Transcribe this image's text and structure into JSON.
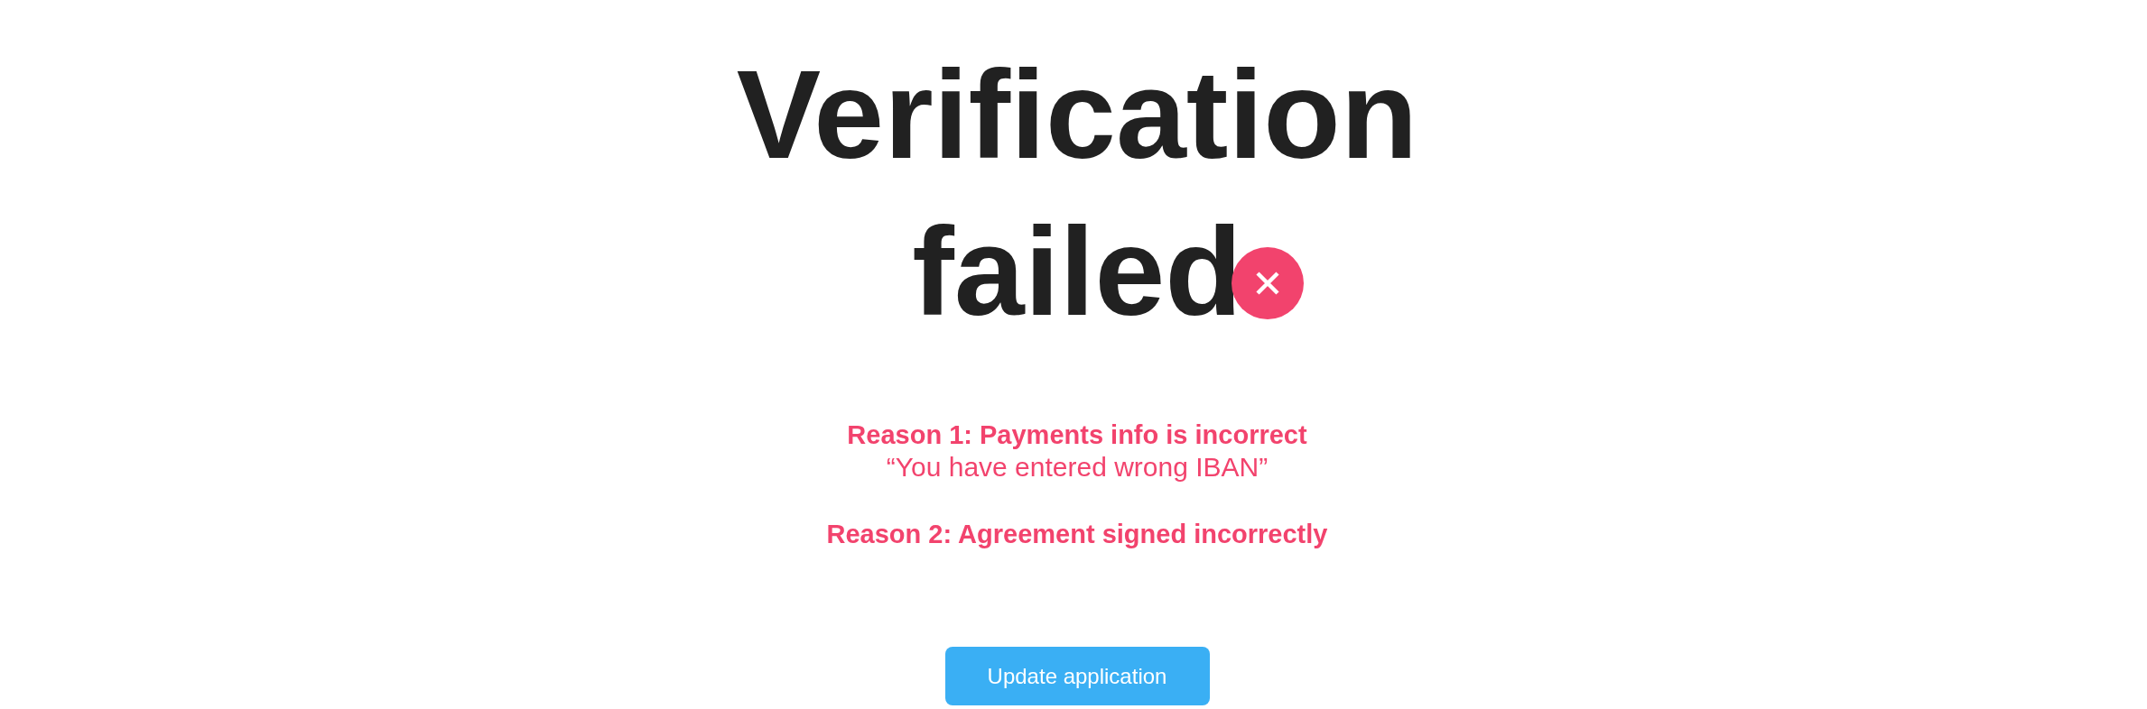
{
  "title_lines": [
    "Verification",
    "failed"
  ],
  "reasons": [
    {
      "title": "Reason 1: Payments info is incorrect",
      "detail": "“You have entered wrong IBAN”"
    },
    {
      "title": "Reason 2: Agreement signed incorrectly"
    }
  ],
  "button": {
    "label": "Update application"
  }
}
